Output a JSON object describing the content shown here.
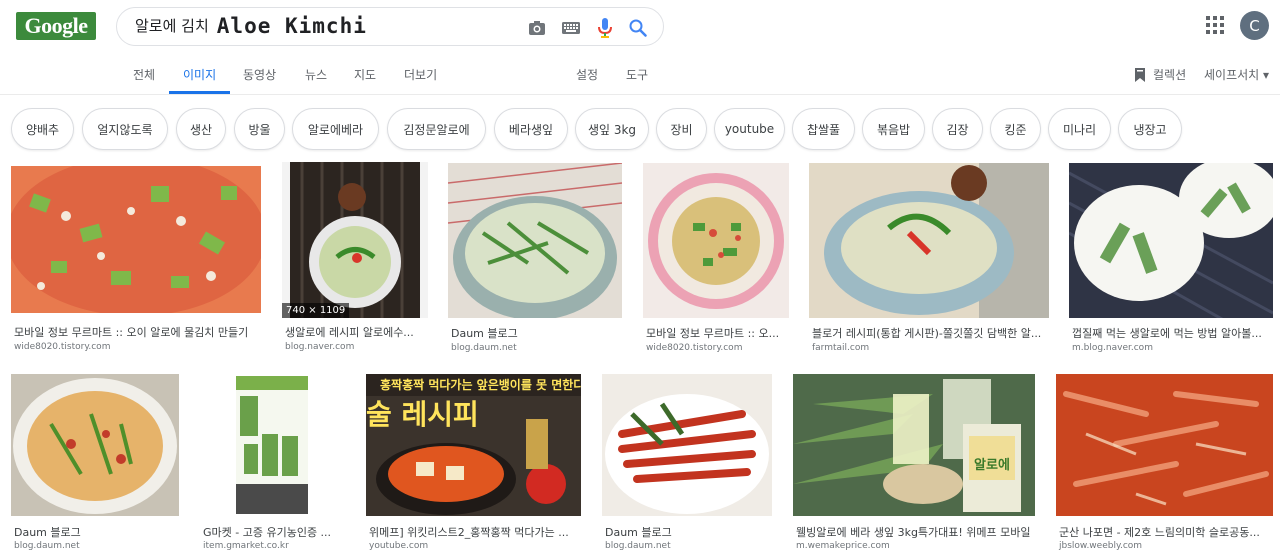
{
  "header": {
    "logo_text": "Google",
    "search_query_ko": "알로에 김치",
    "search_query_en": "Aloe Kimchi",
    "avatar_letter": "C",
    "icons": [
      "camera-icon",
      "keyboard-icon",
      "microphone-icon",
      "search-icon",
      "apps-grid-icon"
    ]
  },
  "tabs": {
    "items": [
      "전체",
      "이미지",
      "동영상",
      "뉴스",
      "지도",
      "더보기"
    ],
    "active": "이미지",
    "settings": "설정",
    "tools": "도구",
    "collections": "컬렉션",
    "safesearch": "세이프서치 ▾"
  },
  "chips": [
    "양배추",
    "얼지않도록",
    "생산",
    "방울",
    "알로에베라",
    "김정문알로에",
    "베라생잎",
    "생잎 3kg",
    "장비",
    "youtube",
    "찹쌀풀",
    "볶음밥",
    "김장",
    "킹준",
    "미나리",
    "냉장고"
  ],
  "results": [
    {
      "title": "모바일 정보 무르마트 :: 오이 알로에 물김치 만들기",
      "site": "wide8020.tistory.com"
    },
    {
      "title": "생알로에 레시피 알로에수...",
      "site": "blog.naver.com",
      "badge": "740 × 1109"
    },
    {
      "title": "Daum 블로그",
      "site": "blog.daum.net"
    },
    {
      "title": "모바일 정보 무르마트 :: 오...",
      "site": "wide8020.tistory.com"
    },
    {
      "title": "블로거 레시피(통합 게시판)-쫄깃쫄깃 담백한 알...",
      "site": "farmtail.com"
    },
    {
      "title": "껍질째 먹는 생알로에 먹는 방법 알아볼...",
      "site": "m.blog.naver.com"
    },
    {
      "title": "Daum 블로그",
      "site": "blog.daum.net"
    },
    {
      "title": "G마켓 - 고증 유기농인증 ...",
      "site": "item.gmarket.co.kr"
    },
    {
      "title": "위메프] 위킷리스트2_홍짝홍짝 먹다가는 ...",
      "site": "youtube.com"
    },
    {
      "title": "Daum 블로그",
      "site": "blog.daum.net"
    },
    {
      "title": "웰빙알로에 베라 생잎 3kg특가대표! 위메프 모바일",
      "site": "m.wemakeprice.com"
    },
    {
      "title": "군산 나포면 - 제2호 느림의미학 슬로공동...",
      "site": "jbslow.weebly.com"
    }
  ],
  "image_overlays": {
    "recipe_banner_line1": "홍짝홍짝 먹다가는 앞은뱅이를 못 면한다",
    "recipe_banner_line2": "술 레시피",
    "package_label": "알로에"
  },
  "colors": {
    "accent_blue": "#1a73e8",
    "logo_green": "#3c8a3c",
    "text_gray": "#5f6368"
  }
}
